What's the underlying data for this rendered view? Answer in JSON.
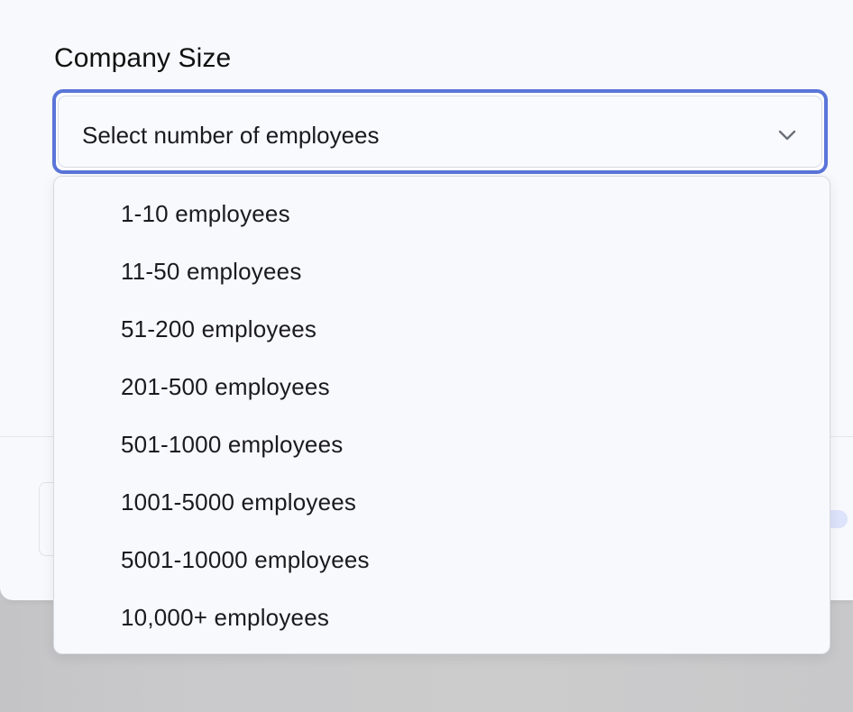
{
  "field": {
    "label": "Company Size",
    "placeholder": "Select number of employees"
  },
  "icons": {
    "chevron": "chevron-down-icon"
  },
  "colors": {
    "focus_ring": "#5a75d8",
    "surface": "#f8f9fc",
    "backdrop": "#c9c9cc"
  },
  "dropdown": {
    "options": [
      {
        "label": "1-10 employees"
      },
      {
        "label": "11-50 employees"
      },
      {
        "label": "51-200 employees"
      },
      {
        "label": "201-500 employees"
      },
      {
        "label": "501-1000 employees"
      },
      {
        "label": "1001-5000 employees"
      },
      {
        "label": "5001-10000 employees"
      },
      {
        "label": "10,000+ employees"
      }
    ]
  }
}
